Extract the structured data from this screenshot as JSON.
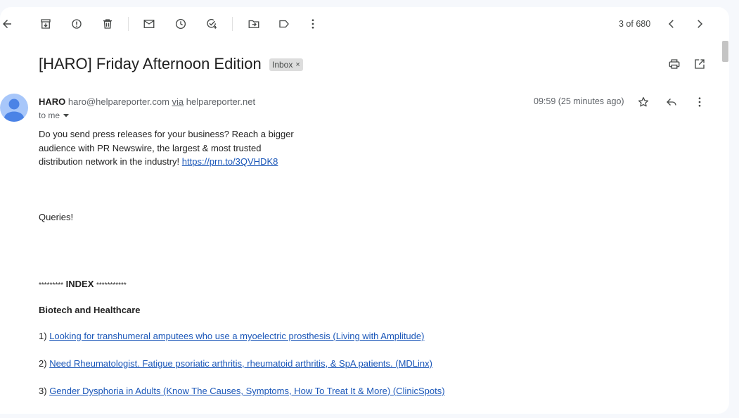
{
  "toolbar": {
    "counter": "3 of 680"
  },
  "email": {
    "subject": "[HARO] Friday Afternoon Edition",
    "label_chip": "Inbox",
    "label_remove": "×",
    "sender_name": "HARO",
    "sender_email": "haro@helpareporter.com",
    "via_word": "via",
    "via_domain": "helpareporter.net",
    "to_me": "to me",
    "time": "09:59 (25 minutes ago)"
  },
  "body": {
    "promo_line1": "Do you send press releases for your business? Reach a bigger",
    "promo_line2": "audience with PR Newswire, the largest & most trusted",
    "promo_line3": "distribution network in the industry!",
    "promo_link": "https://prn.to/3QVHDK8",
    "queries": "Queries!",
    "index_left": "*********",
    "index_word": "INDEX",
    "index_right": "***********",
    "section_heading": "Biotech and Healthcare",
    "items": [
      {
        "num": "1)",
        "text": "Looking for transhumeral amputees who use a myoelectric prosthesis (Living with Amplitude)"
      },
      {
        "num": "2)",
        "text": "Need Rheumatologist. Fatigue psoriatic arthritis, rheumatoid arthritis, & SpA patients. (MDLinx)"
      },
      {
        "num": "3)",
        "text": "Gender Dysphoria in Adults (Know The Causes, Symptoms, How To Treat It & More) (ClinicSpots)"
      }
    ]
  },
  "icons": {
    "back": "arrow-left-icon",
    "archive": "archive-icon",
    "spam": "report-spam-icon",
    "delete": "trash-icon",
    "unread": "mark-unread-icon",
    "snooze": "clock-icon",
    "task": "add-task-icon",
    "move": "move-to-icon",
    "label": "label-icon",
    "more": "more-vert-icon"
  }
}
